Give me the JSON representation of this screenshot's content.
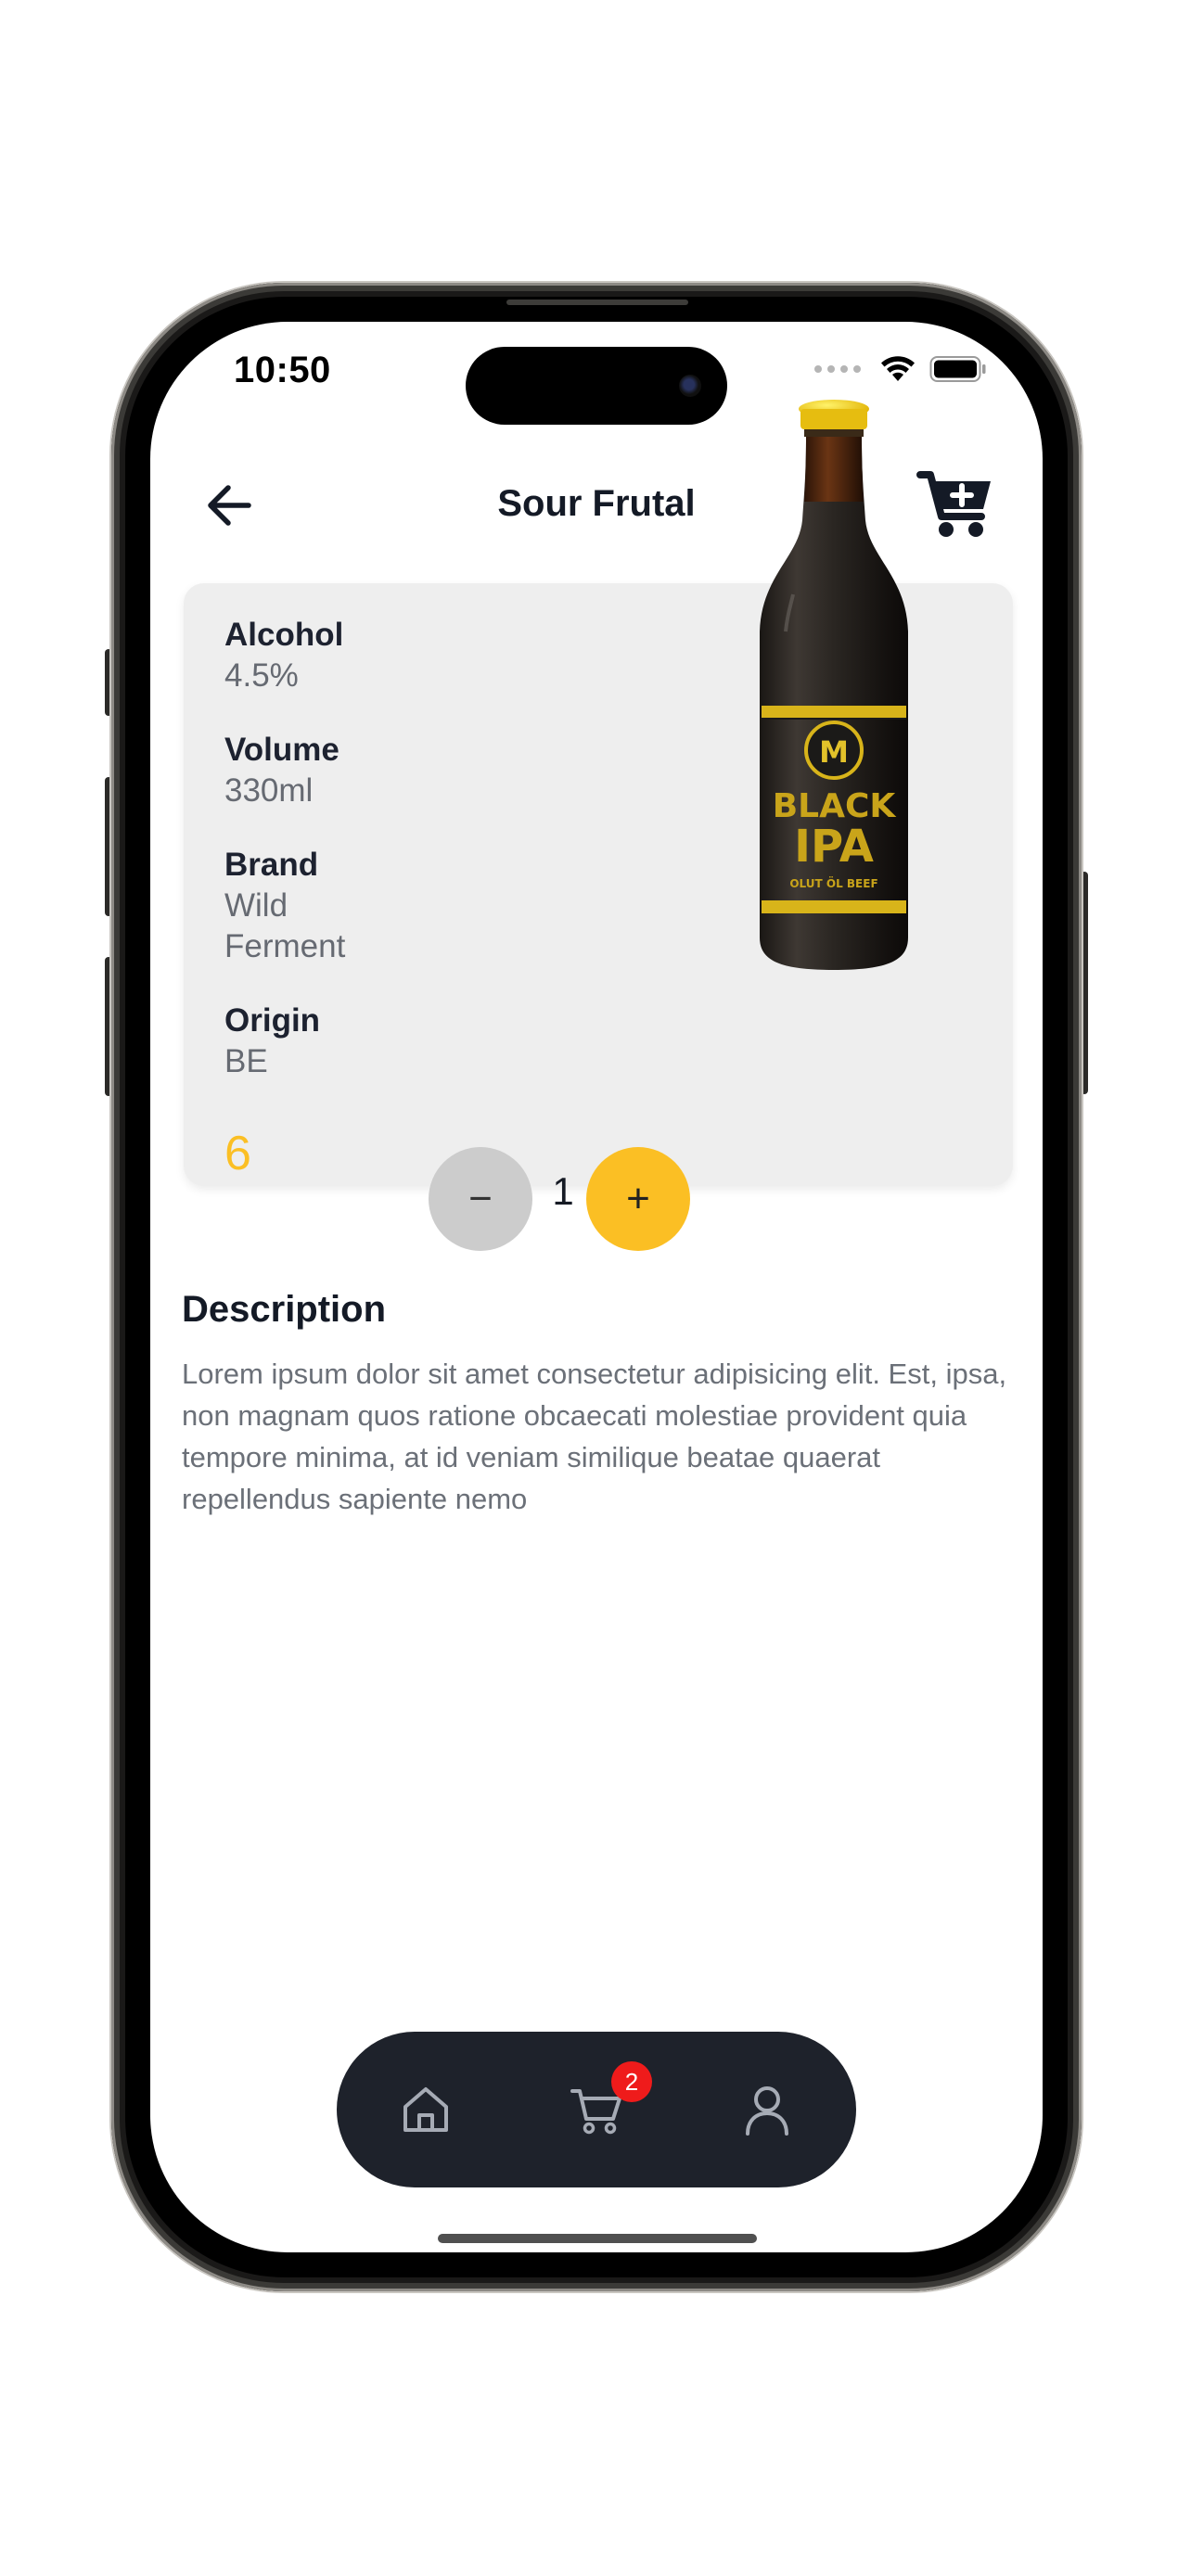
{
  "status_bar": {
    "time": "10:50"
  },
  "header": {
    "title": "Sour Frutal"
  },
  "product": {
    "specs": [
      {
        "label": "Alcohol",
        "value": "4.5%"
      },
      {
        "label": "Volume",
        "value": "330ml"
      },
      {
        "label": "Brand",
        "value": "Wild Ferment"
      },
      {
        "label": "Origin",
        "value": "BE"
      }
    ],
    "price": "6",
    "bottle_label": {
      "top": "BLACK",
      "bottom": "IPA",
      "tag": "OLUT ÖL BEEF"
    }
  },
  "quantity": {
    "value": "1",
    "minus_symbol": "−",
    "plus_symbol": "+"
  },
  "description": {
    "title": "Description",
    "text": "Lorem ipsum dolor sit amet consectetur adipisicing elit. Est, ipsa, non magnam quos ratione obcaecati molestiae provident quia tempore minima, at id veniam similique beatae quaerat repellendus sapiente nemo"
  },
  "tabbar": {
    "items": [
      {
        "icon": "home-icon"
      },
      {
        "icon": "cart-icon",
        "badge": "2"
      },
      {
        "icon": "user-icon"
      }
    ]
  },
  "colors": {
    "accent": "#fbbf24",
    "tabbar_bg": "#1e222b",
    "badge": "#ef1b1b",
    "card_bg": "#eeeeee"
  }
}
